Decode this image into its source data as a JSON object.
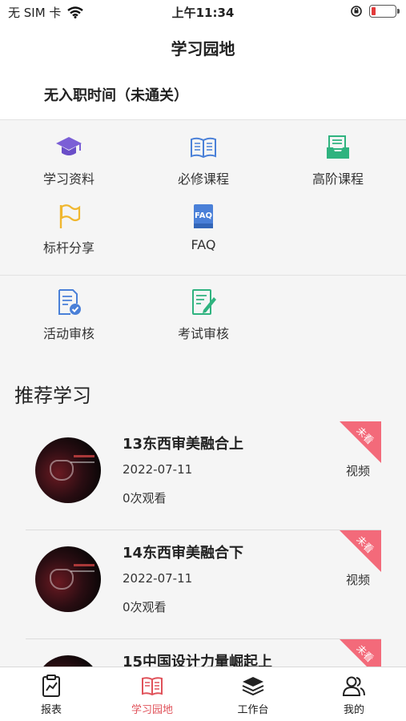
{
  "status_bar": {
    "carrier": "无 SIM 卡",
    "time": "上午11:34"
  },
  "nav": {
    "title": "学习园地"
  },
  "job": {
    "text": "无入职时间（未通关）"
  },
  "grid1": [
    {
      "label": "学习资料",
      "icon": "graduation-cap-icon"
    },
    {
      "label": "必修课程",
      "icon": "open-book-icon"
    },
    {
      "label": "高阶课程",
      "icon": "inbox-tray-icon"
    },
    {
      "label": "标杆分享",
      "icon": "flag-icon"
    },
    {
      "label": "FAQ",
      "icon": "faq-book-icon"
    }
  ],
  "grid2": [
    {
      "label": "活动审核",
      "icon": "document-check-icon"
    },
    {
      "label": "考试审核",
      "icon": "document-edit-icon"
    }
  ],
  "recommend": {
    "title": "推荐学习",
    "items": [
      {
        "title": "13东西审美融合上",
        "date": "2022-07-11",
        "views": "0次观看",
        "type": "视频",
        "badge": "未看"
      },
      {
        "title": "14东西审美融合下",
        "date": "2022-07-11",
        "views": "0次观看",
        "type": "视频",
        "badge": "未看"
      },
      {
        "title": "15中国设计力量崛起上",
        "date": "",
        "views": "",
        "type": "",
        "badge": "未看"
      }
    ]
  },
  "tabs": [
    {
      "label": "报表",
      "icon": "report-clipboard-icon"
    },
    {
      "label": "学习园地",
      "icon": "book-icon"
    },
    {
      "label": "工作台",
      "icon": "layers-icon"
    },
    {
      "label": "我的",
      "icon": "users-icon"
    }
  ],
  "colors": {
    "accent": "#e0525a",
    "badge": "#f36a7a",
    "icon_purple": "#7b5fd6",
    "icon_blue": "#4a80d8",
    "icon_green": "#2fb37f",
    "icon_yellow": "#f0b72f"
  }
}
